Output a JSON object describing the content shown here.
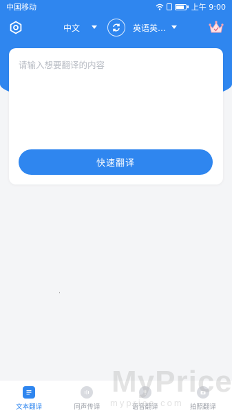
{
  "status_bar": {
    "carrier": "中国移动",
    "time": "上午 9:00"
  },
  "toolbar": {
    "source_lang": "中文",
    "target_lang": "英语英…"
  },
  "input": {
    "placeholder": "请输入想要翻译的内容",
    "value": ""
  },
  "action": {
    "translate_label": "快速翻译"
  },
  "tabs": [
    {
      "label": "文本翻译",
      "icon": "document-icon",
      "active": true
    },
    {
      "label": "同声传译",
      "icon": "microphone-icon",
      "active": false
    },
    {
      "label": "语音翻译",
      "icon": "voice-icon",
      "active": false
    },
    {
      "label": "拍照翻译",
      "icon": "camera-icon",
      "active": false
    }
  ],
  "watermark": {
    "text": "MyPrice",
    "subtext": "myprice.com"
  },
  "colors": {
    "primary": "#2f86ef",
    "background": "#f4f5f7"
  }
}
